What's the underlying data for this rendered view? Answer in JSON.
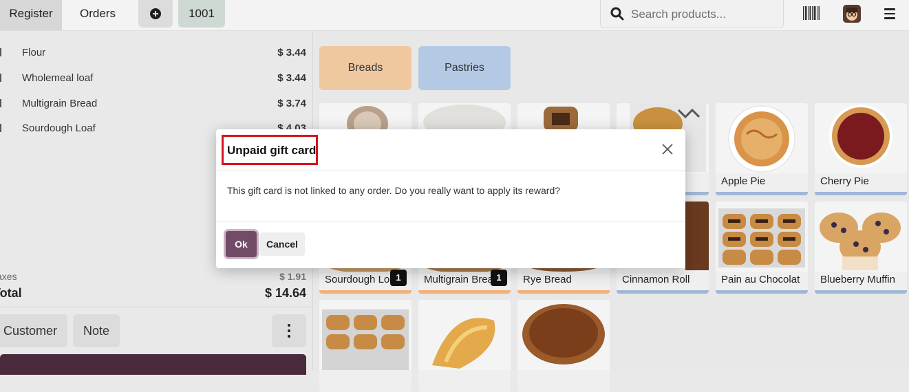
{
  "topbar": {
    "tabs": [
      {
        "label": "Register"
      },
      {
        "label": "Orders"
      }
    ],
    "order_number": "1001",
    "search_placeholder": "Search products..."
  },
  "order_lines": [
    {
      "name": "Flour",
      "price": "$ 3.44"
    },
    {
      "name": "Wholemeal loaf",
      "price": "$ 3.44"
    },
    {
      "name": "Multigrain Bread",
      "price": "$ 3.74"
    },
    {
      "name": "Sourdough Loaf",
      "price": "$ 4.03"
    }
  ],
  "summary": {
    "taxes_label": "Taxes",
    "taxes": "$ 1.91",
    "total_label": "Total",
    "total": "$ 14.64"
  },
  "actions": {
    "customer": "Customer",
    "note": "Note"
  },
  "categories": [
    {
      "label": "Breads",
      "color": "#f0c8a0"
    },
    {
      "label": "Pastries",
      "color": "#b4c9e4"
    }
  ],
  "products": [
    {
      "name": "Sourdough Loaf",
      "qty": "1"
    },
    {
      "name": "Multigrain Bread",
      "qty": "1"
    },
    {
      "name": "Rye Bread"
    },
    {
      "name": "Cinnamon Roll"
    },
    {
      "name": "Apple Pie"
    },
    {
      "name": "Cherry Pie"
    },
    {
      "name": "Pain au Chocolat"
    },
    {
      "name": "Blueberry Muffin"
    }
  ],
  "colors": {
    "breads_bar": "#f0b27a",
    "pastries_bar": "#9fb8d8",
    "primary": "#714b67",
    "highlight": "#d4161f"
  },
  "dialog": {
    "title": "Unpaid gift card",
    "body": "This gift card is not linked to any order. Do you really want to apply its reward?",
    "ok": "Ok",
    "cancel": "Cancel"
  }
}
